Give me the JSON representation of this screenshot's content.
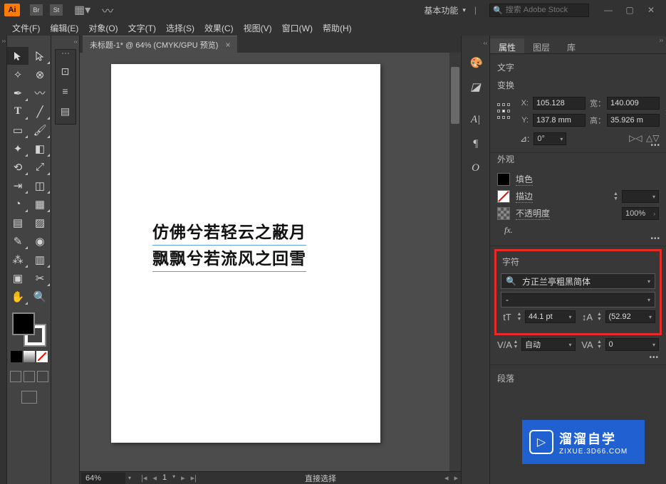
{
  "app": {
    "logo": "Ai"
  },
  "workspace": {
    "label": "基本功能"
  },
  "search": {
    "placeholder": "搜索 Adobe Stock"
  },
  "menu": [
    "文件(F)",
    "编辑(E)",
    "对象(O)",
    "文字(T)",
    "选择(S)",
    "效果(C)",
    "视图(V)",
    "窗口(W)",
    "帮助(H)"
  ],
  "doc": {
    "tab": "未标题-1* @ 64% (CMYK/GPU 预览)"
  },
  "artboard": {
    "line1": "仿佛兮若轻云之蔽月",
    "line2": "飘飘兮若流风之回雪"
  },
  "status": {
    "zoom": "64%",
    "mode": "直接选择"
  },
  "panel": {
    "tabs": {
      "properties": "属性",
      "layers": "图层",
      "libraries": "库"
    },
    "section_type": "文字",
    "transform": {
      "title": "变换",
      "x_label": "X:",
      "x": "105.128",
      "y_label": "Y:",
      "y": "137.8 mm",
      "w_label": "宽：",
      "w": "140.009",
      "h_label": "高：",
      "h": "35.926 m",
      "angle_label": "⊿:",
      "angle": "0°"
    },
    "appearance": {
      "title": "外观",
      "fill": "填色",
      "stroke": "描边",
      "opacity": "不透明度",
      "opacity_value": "100%",
      "fx": "fx."
    },
    "character": {
      "title": "字符",
      "font": "方正兰亭粗黑简体",
      "style": "-",
      "size": "44.1 pt",
      "leading": "(52.92",
      "kerning": "自动",
      "tracking": "0"
    },
    "paragraph": {
      "title": "段落"
    }
  },
  "watermark": {
    "name": "溜溜自学",
    "url": "ZIXUE.3D66.COM"
  }
}
